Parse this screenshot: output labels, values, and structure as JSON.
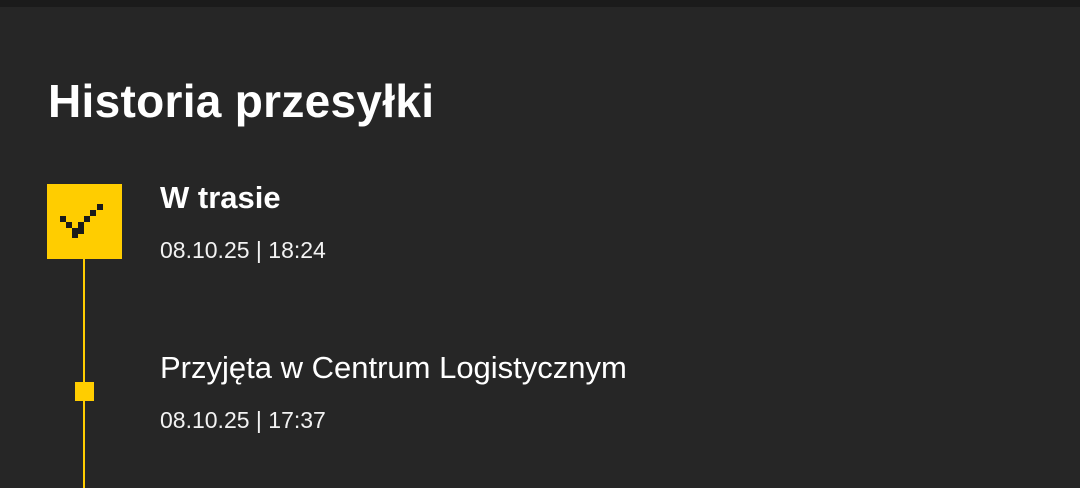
{
  "page": {
    "title": "Historia przesyłki"
  },
  "timeline": {
    "events": [
      {
        "status": "W trasie",
        "datetime": "08.10.25 | 18:24",
        "icon": "checkmark-icon",
        "current": true
      },
      {
        "status": "Przyjęta w Centrum Logistycznym",
        "datetime": "08.10.25 | 17:37",
        "icon": "timeline-dot-icon",
        "current": false
      }
    ]
  },
  "colors": {
    "background": "#262626",
    "accent": "#ffcd00",
    "text": "#ffffff"
  }
}
